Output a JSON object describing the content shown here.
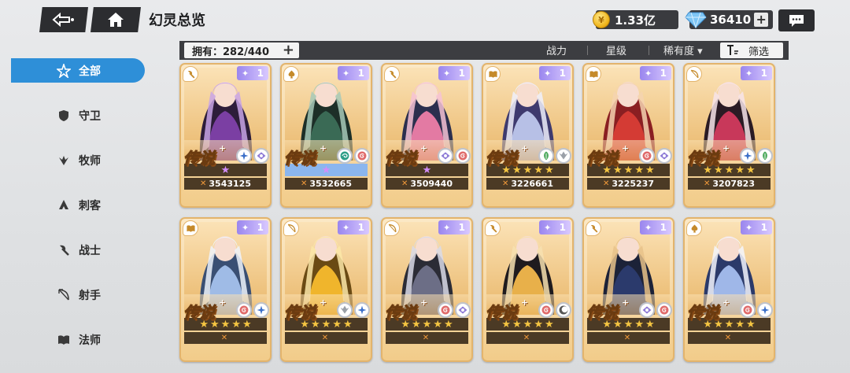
{
  "header": {
    "title": "幻灵总览",
    "gold": "1.33亿",
    "gems": "36410",
    "back_icon": "back-arrow-icon",
    "home_icon": "home-icon",
    "chat_icon": "chat-bubble-icon"
  },
  "filterbar": {
    "owned_label": "拥有：282/440",
    "sort_power": "战力",
    "sort_star": "星级",
    "sort_rarity": "稀有度 ▾",
    "filter_label": "筛选"
  },
  "sidebar": {
    "items": [
      {
        "label": "全部",
        "icon": "star-all-icon",
        "active": true
      },
      {
        "label": "守卫",
        "icon": "shield-icon",
        "active": false
      },
      {
        "label": "牧师",
        "icon": "wing-icon",
        "active": false
      },
      {
        "label": "刺客",
        "icon": "mask-icon",
        "active": false
      },
      {
        "label": "战士",
        "icon": "axe-icon",
        "active": false
      },
      {
        "label": "射手",
        "icon": "bow-icon",
        "active": false
      },
      {
        "label": "法师",
        "icon": "book-icon",
        "active": false
      }
    ]
  },
  "cards": [
    {
      "rarity": "传说",
      "level": "1",
      "class_icon": "axe-icon",
      "elements": [
        "star-element-icon",
        "eye-element-icon"
      ],
      "stars": 0,
      "pink_stars": 1,
      "power": "3543125",
      "palette": [
        "#2d1d3a",
        "#7b3fa3",
        "#c9a4e8"
      ]
    },
    {
      "rarity": "传说",
      "level": "1",
      "class_icon": "spade-icon",
      "elements": [
        "wind-element-icon",
        "spiral-element-icon"
      ],
      "stars": 0,
      "pink_stars": 1,
      "power": "3532665",
      "palette": [
        "#1d2f28",
        "#3a6a55",
        "#a7c9b8"
      ],
      "blue_stars": true
    },
    {
      "rarity": "传说",
      "level": "1",
      "class_icon": "axe-icon",
      "elements": [
        "eye-element-icon",
        "spiral-element-icon"
      ],
      "stars": 0,
      "pink_stars": 1,
      "power": "3509440",
      "palette": [
        "#2b2f4e",
        "#e37aa3",
        "#f6c2d6"
      ]
    },
    {
      "rarity": "传说",
      "level": "1",
      "class_icon": "book-icon",
      "elements": [
        "leaf-element-icon",
        "wing-element-icon"
      ],
      "stars": 5,
      "pink_stars": 0,
      "power": "3226661",
      "palette": [
        "#3e3a6e",
        "#b7c0e6",
        "#eef0fb"
      ]
    },
    {
      "rarity": "传说",
      "level": "1",
      "class_icon": "book-icon",
      "elements": [
        "spiral-element-icon",
        "eye-element-icon"
      ],
      "stars": 5,
      "pink_stars": 0,
      "power": "3225237",
      "palette": [
        "#8a1f22",
        "#d43b34",
        "#f4d3b0"
      ]
    },
    {
      "rarity": "传说",
      "level": "1",
      "class_icon": "bow-icon",
      "elements": [
        "star-element-icon",
        "leaf-element-icon"
      ],
      "stars": 5,
      "pink_stars": 0,
      "power": "3207823",
      "palette": [
        "#2a1b24",
        "#c8385a",
        "#f7e4ea"
      ]
    },
    {
      "rarity": "传说",
      "level": "1",
      "class_icon": "book-icon",
      "elements": [
        "spiral-element-icon",
        "star-element-icon"
      ],
      "stars": 5,
      "pink_stars": 0,
      "power": "",
      "palette": [
        "#3a4f73",
        "#9fbbe6",
        "#eef3fb"
      ]
    },
    {
      "rarity": "传说",
      "level": "1",
      "class_icon": "bow-icon",
      "elements": [
        "wing-element-icon",
        "star-element-icon"
      ],
      "stars": 5,
      "pink_stars": 0,
      "power": "",
      "palette": [
        "#6a4a14",
        "#f0b52c",
        "#fbe8a8"
      ]
    },
    {
      "rarity": "传说",
      "level": "1",
      "class_icon": "bow-icon",
      "elements": [
        "spiral-element-icon",
        "eye-element-icon"
      ],
      "stars": 5,
      "pink_stars": 0,
      "power": "",
      "palette": [
        "#2b2c36",
        "#6c6e86",
        "#d9dbe8"
      ]
    },
    {
      "rarity": "传说",
      "level": "1",
      "class_icon": "axe-icon",
      "elements": [
        "spiral-element-icon",
        "moon-element-icon"
      ],
      "stars": 5,
      "pink_stars": 0,
      "power": "",
      "palette": [
        "#1f1b1e",
        "#e8b04a",
        "#f7e0b0"
      ]
    },
    {
      "rarity": "传说",
      "level": "1",
      "class_icon": "axe-icon",
      "elements": [
        "eye-element-icon",
        "spiral-element-icon"
      ],
      "stars": 5,
      "pink_stars": 0,
      "power": "",
      "palette": [
        "#1c2238",
        "#2b3a6c",
        "#e7c28a"
      ]
    },
    {
      "rarity": "传说",
      "level": "1",
      "class_icon": "spade-icon",
      "elements": [
        "spiral-element-icon",
        "star-element-icon"
      ],
      "stars": 5,
      "pink_stars": 0,
      "power": "",
      "palette": [
        "#2b3a6a",
        "#9fb7e8",
        "#f3f6fd"
      ]
    }
  ],
  "colors": {
    "accent": "#2e8fd8",
    "card_border": "#e3b46c",
    "level_tag": "#9a86ee",
    "dark_bar": "#3c3d41"
  }
}
